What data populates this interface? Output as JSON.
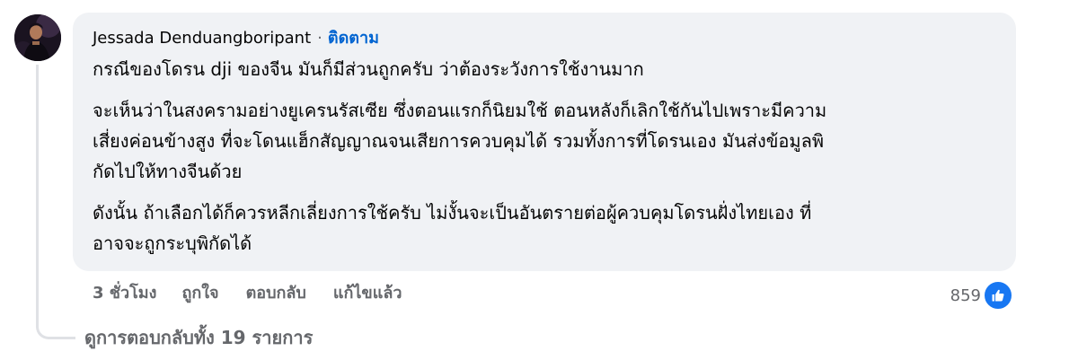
{
  "comment": {
    "author": "Jessada Denduangboripant",
    "separator": "·",
    "follow_label": "ติดตาม",
    "paragraphs": [
      "กรณีของโดรน dji ของจีน มันก็มีส่วนถูกครับ ว่าต้องระวังการใช้งานมาก",
      "จะเห็นว่าในสงครามอย่างยูเครนรัสเซีย ซึ่งตอนแรกก็นิยมใช้ ตอนหลังก็เลิกใช้กันไปเพราะมีความ",
      "เสี่ยงค่อนข้างสูง ที่จะโดนแฮ็กสัญญาณจนเสียการควบคุมได้ รวมทั้งการที่โดรนเอง มันส่งข้อมูลพิ",
      "กัดไปให้ทางจีนด้วย",
      "ดังนั้น ถ้าเลือกได้ก็ควรหลีกเลี่ยงการใช้ครับ ไม่งั้นจะเป็นอันตรายต่อผู้ควบคุมโดรนฝั่งไทยเอง ที่",
      "อาจจะถูกระบุพิกัดได้"
    ]
  },
  "actions": {
    "time": "3 ชั่วโมง",
    "like": "ถูกใจ",
    "reply": "ตอบกลับ",
    "edited": "แก้ไขแล้ว"
  },
  "reactions": {
    "count": "859",
    "icon": "thumbs-up-icon",
    "color": "#1877f2"
  },
  "view_replies": "ดูการตอบกลับทั้ง 19 รายการ",
  "colors": {
    "bubble": "#f0f2f5",
    "follow": "#0064d1",
    "meta": "#65676b"
  }
}
